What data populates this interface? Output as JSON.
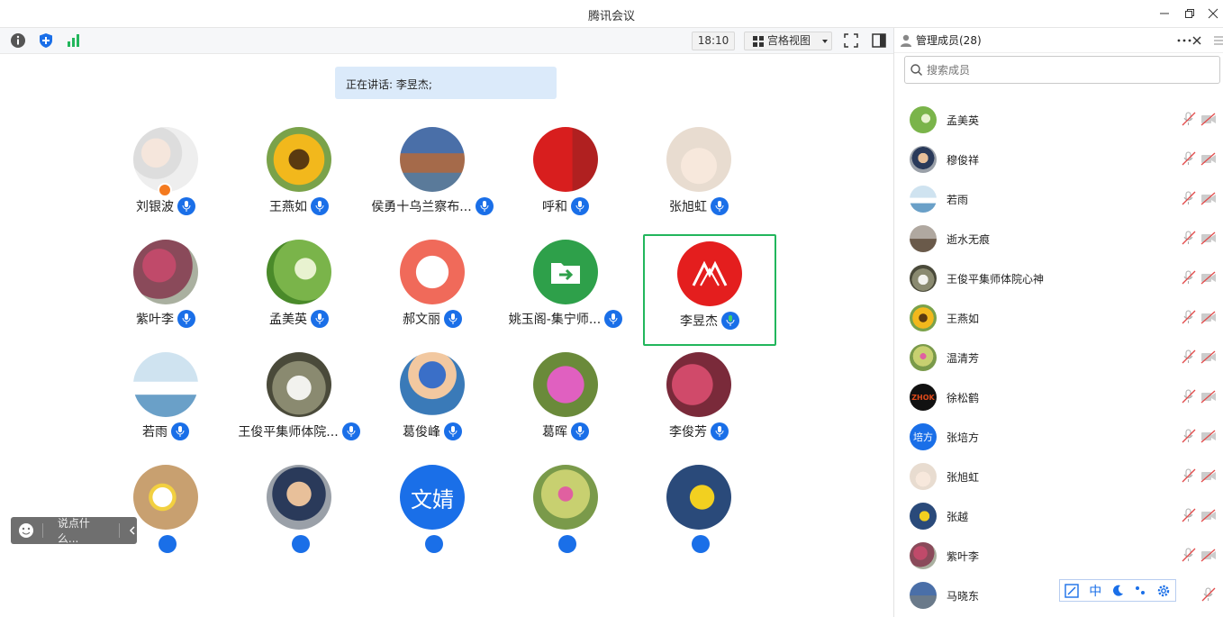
{
  "window": {
    "title": "腾讯会议"
  },
  "toolbar": {
    "time": "18:10",
    "view_label": "宫格视图"
  },
  "speaking": {
    "text": "正在讲话: 李昱杰;"
  },
  "tiles": [
    {
      "name": "刘银波",
      "host": true
    },
    {
      "name": "王燕如"
    },
    {
      "name": "侯勇十乌兰察布..."
    },
    {
      "name": "呼和"
    },
    {
      "name": "张旭虹"
    },
    {
      "name": "紫叶李"
    },
    {
      "name": "孟美英"
    },
    {
      "name": "郝文丽"
    },
    {
      "name": "姚玉阁-集宁师..."
    },
    {
      "name": "李昱杰",
      "selected": true,
      "speaking": true
    },
    {
      "name": "若雨"
    },
    {
      "name": "王俊平集师体院..."
    },
    {
      "name": "葛俊峰"
    },
    {
      "name": "葛晖"
    },
    {
      "name": "李俊芳"
    },
    {
      "name": ""
    },
    {
      "name": ""
    },
    {
      "name": "",
      "avatar_text": "文婧"
    },
    {
      "name": ""
    },
    {
      "name": ""
    }
  ],
  "chat": {
    "placeholder": "说点什么..."
  },
  "panel": {
    "title": "管理成员(28)",
    "search_placeholder": "搜索成员",
    "members": [
      {
        "name": "孟美英"
      },
      {
        "name": "穆俊祥"
      },
      {
        "name": "若雨"
      },
      {
        "name": "逝水无痕"
      },
      {
        "name": "王俊平集师体院心神"
      },
      {
        "name": "王燕如"
      },
      {
        "name": "温清芳"
      },
      {
        "name": "徐松鹤",
        "avatar_text": "ZHOK"
      },
      {
        "name": "张培方",
        "avatar_text": "培方"
      },
      {
        "name": "张旭虹"
      },
      {
        "name": "张越"
      },
      {
        "name": "紫叶李"
      },
      {
        "name": "马晓东"
      }
    ]
  },
  "float_toolbar": {
    "lang": "中"
  },
  "colors": {
    "accent": "#1a6fe8",
    "selected": "#22b65c",
    "speaking_bg": "#dbeafa"
  }
}
